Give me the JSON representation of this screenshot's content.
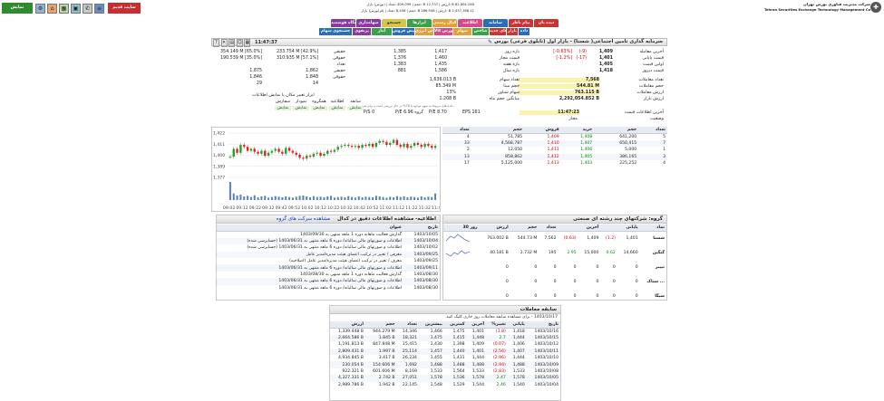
{
  "company": {
    "fa": "شرکت مدیریت فناوری بورس تهران",
    "en": "Tehran Securities Exchange Technology Management Co"
  },
  "ticker": {
    "l1": "82,804,246 B :ارزش | 12,737 B :حجم | 409,099 :تعداد | (بورس) بازار",
    "l2": "2,437,168.11 B :ارزش | 286,948 B :حجم | 8,458 :تعداد | (فرابورس) بازار"
  },
  "top_btns": {
    "site": "سایت قدیم",
    "lang": "نمایش فهرست"
  },
  "menus_row1": [
    "دیده بان",
    "پیام ناظر",
    "سامانه",
    "اطلاعیه",
    "کدال رسمی",
    "ابزارها",
    "جستجو",
    "سهامداری",
    "ایستگاه هوشمند",
    "تقویم",
    "تحلیل"
  ],
  "menus_row2": [
    "داده",
    "بازار",
    "نمادهای جدید",
    "شاخص",
    "سهام",
    "بورس کالا",
    "بورس انرژی",
    "پیش فروش",
    "آمار",
    "پرتفوی",
    "جستجوی سهام"
  ],
  "header": {
    "title": "سرمایه گذاری تامین اجتماعی( شستا) - بازار اول (تابلوی فرعی) بورس",
    "time": "11:47:37"
  },
  "price_block": {
    "rows": [
      {
        "label": "آخرین معامله",
        "val": "1,409",
        "chg": "(-9)",
        "pct": "[-0.63%]"
      },
      {
        "label": "قیمت پایانی",
        "val": "1,401",
        "chg": "(-17)",
        "pct": "[-1.2%]"
      },
      {
        "label": "اولین قیمت",
        "val": "1,405",
        "chg": "",
        "pct": ""
      },
      {
        "label": "قیمت دیروز",
        "val": "1,418",
        "chg": "",
        "pct": ""
      }
    ],
    "range": [
      {
        "label": "بازه روز",
        "a": "1,417",
        "b": "1,385"
      },
      {
        "label": "قیمت مجاز",
        "a": "1,460",
        "b": "1,376"
      },
      {
        "label": "بازه هفته",
        "a": "1,435",
        "b": "1,383"
      },
      {
        "label": "بازه سال",
        "a": "1,586",
        "b": "881"
      }
    ],
    "stats": [
      {
        "label": "تعداد معاملات",
        "val": "7,568"
      },
      {
        "label": "حجم معاملات",
        "val": "544.81 M"
      },
      {
        "label": "ارزش معاملات",
        "val": "763.115 B"
      },
      {
        "label": "ارزش بازار",
        "val": "2,292,054.852 B"
      }
    ],
    "stats2": [
      {
        "label": "تعداد سهام",
        "val": "1,636.013 B"
      },
      {
        "label": "حجم مبنا",
        "val": "85.349 M"
      },
      {
        "label": "سهام شناور",
        "val": "13%"
      },
      {
        "label": "میانگین حجم ماه",
        "val": "1.208 B"
      }
    ],
    "last_info_label": "آخرین اطلاعات قیمت",
    "last_info_val": "11:47:23",
    "status_label": "وضعیت",
    "status_val": "مجاز",
    "eps": "EPS 161",
    "pe": "P/E 8.70",
    "gpe": "P/E گروه 6.96",
    "psr": "P/S 0",
    "note": "داده های مربوط به سهم موجود با 70% در حال بررسی است و برای هر سهم..."
  },
  "clients": {
    "head": [
      "",
      "خرید",
      "فروش"
    ],
    "rows": [
      {
        "label": "حقیقی",
        "buy": "233.754 M [42.9%]",
        "sell": "354.149 M [65.0%]"
      },
      {
        "label": "حقوقی",
        "buy": "310.935 M [57.1%]",
        "sell": "190.539 M [35.0%]"
      },
      {
        "label": "تعداد",
        "buy": "",
        "sell": ""
      },
      {
        "label": "حقیقی",
        "buy": "1,862",
        "sell": "1,875"
      },
      {
        "label": "حقوقی",
        "buy": "1,848",
        "sell": "1,846"
      },
      {
        "label": "",
        "buy": "14",
        "sell": "29"
      }
    ],
    "tools_label": "ابزار تغییر مکان یا نمایش اطلاعات",
    "tools": [
      [
        "سابقه",
        "اطلاعیه",
        "همگروه",
        "نمودار",
        "سفارش"
      ],
      [
        "نمایش",
        "نمایش",
        "نمایش",
        "نمایش",
        "نمایش"
      ]
    ]
  },
  "orderbook": {
    "head": [
      "تعداد",
      "حجم",
      "خرید",
      "فروش",
      "حجم",
      "تعداد"
    ],
    "rows": [
      [
        "5",
        "641,200",
        "1,408",
        "1,409",
        "51,785",
        "4"
      ],
      [
        "7",
        "650,415",
        "1,407",
        "1,410",
        "4,568,787",
        "33"
      ],
      [
        "1",
        "5,000",
        "1,406",
        "1,411",
        "12,050",
        "2"
      ],
      [
        "3",
        "386,165",
        "1,405",
        "1,412",
        "858,862",
        "13"
      ],
      [
        "4",
        "225,252",
        "1,403",
        "1,413",
        "5,125,000",
        "17"
      ]
    ]
  },
  "chart_data": {
    "type": "line",
    "series": [
      {
        "values": [
          1398,
          1406,
          1402,
          1410,
          1408,
          1404,
          1406,
          1403,
          1401,
          1404,
          1399,
          1402,
          1404,
          1406,
          1403,
          1401,
          1407,
          1404,
          1402,
          1400,
          1397,
          1396,
          1399,
          1398,
          1401,
          1402,
          1399,
          1401,
          1404,
          1403,
          1405,
          1408,
          1409,
          1410,
          1409,
          1408,
          1409,
          1407,
          1410,
          1409,
          1411,
          1408,
          1412,
          1414,
          1413,
          1410,
          1412,
          1415,
          1410,
          1408,
          1411,
          1407,
          1409,
          1412,
          1410,
          1408,
          1411,
          1409,
          1407,
          1409
        ]
      }
    ],
    "volume": [
      60,
      22,
      15,
      18,
      12,
      14,
      10,
      16,
      9,
      12,
      14,
      8,
      10,
      13,
      11,
      9,
      12,
      10,
      8,
      11,
      14,
      15,
      12,
      9,
      13,
      10,
      11,
      9,
      12,
      14,
      8,
      10,
      11,
      9,
      13,
      10,
      8,
      12,
      9,
      11,
      10,
      9,
      14,
      12,
      10,
      8,
      11,
      9,
      13,
      10,
      12,
      9,
      11,
      10,
      8,
      12,
      9,
      11,
      10,
      22
    ],
    "yticks": [
      "1,422",
      "1,411",
      "1,400",
      "1,389",
      "1,377"
    ],
    "ylim": [
      1377,
      1422
    ],
    "xticks": [
      "09:02",
      "09:12",
      "09:22",
      "09:32",
      "09:42",
      "09:52",
      "10:02",
      "10:12",
      "10:22",
      "10:32",
      "10:42",
      "10:52",
      "11:02",
      "11:12",
      "11:22",
      "11:32",
      "11:42"
    ],
    "grid": true
  },
  "peers": {
    "title": "گروه: شرکتهای چند رشته ای صنعتی",
    "head": [
      "نماد",
      "پایانی",
      "",
      "آخرین",
      "",
      "تعداد",
      "حجم",
      "ارزش",
      "30 روز"
    ],
    "rows": [
      [
        "شستا",
        "1,401",
        "(1.2)",
        "1,409",
        "(0.63)",
        "7,562",
        "544.73 M",
        "763.002 B"
      ],
      [
        "گنگین",
        "14,660",
        "0.62",
        "15,000",
        "2.95",
        "195",
        "2.732 M",
        "40.181 B"
      ],
      [
        "تیپیر",
        "0",
        "0",
        "0",
        "0",
        "0",
        "0",
        "0"
      ],
      [
        "ستاک ...",
        "0",
        "0",
        "0",
        "0",
        "0",
        "0",
        "0"
      ],
      [
        "سیگا",
        "0",
        "0",
        "0",
        "0",
        "0",
        "0",
        "0"
      ]
    ]
  },
  "news": {
    "title": "اطلاعیه- مشاهده اطلاعات دقیق در کدال",
    "link": "مشاهده سرکت های گروه",
    "head": [
      "تاریخ",
      "عنوان"
    ],
    "rows": [
      [
        "1403/10/05",
        "گذارش فعالیت ماهانه دوره 1 ماهه منتهی به 1403/09/30"
      ],
      [
        "1403/10/04",
        "اطلاعات و صورتهای مالی سالیانه/ دوره 6 ماهه منتهی به 1403/06/31 (حسابرسی شده)"
      ],
      [
        "1403/10/02",
        "اطلاعات و صورتهای مالی سالیانه/ دوره 6 ماهه منتهی به 1403/06/31 (حسابرسی شده)"
      ],
      [
        "1403/09/25",
        "معرفی / تغییر در ترکیب اعضای هیئت مدیره/مدیر عامل"
      ],
      [
        "1403/09/25",
        "معرف / تغییر در ترکیب اعضای هیئت مدیره/مدیر عامل (اصلاحیه)"
      ],
      [
        "1403/09/11",
        "اطلاعات و صورتهای مالی سالیانه/ دوره 6 ماهه منتهی به 1403/06/31"
      ],
      [
        "1403/08/30",
        "گذارش فعالیت ماهانه دوره 1 ماهه منتهی به 1403/08/30"
      ],
      [
        "1403/08/30",
        "اطلاعات و صورتهای مالی سالیانه/ دوره 6 ماهه منتهی به 1403/06/31"
      ],
      [
        "1403/08/30",
        "اطلاعات و صورتهای مالی سالیانه/ دوره 6 ماهه منتهی به 1403/06/31"
      ]
    ]
  },
  "history": {
    "title": "سابقه معاملات",
    "sub": "1403/10/17 - برای مشاهده سابقه معاملات روز جاری کلیک کنید",
    "head": [
      "تاریخ",
      "پایانی",
      "%تغییر",
      "آخرین",
      "کمترین",
      "بیشترین",
      "تعداد",
      "حجم",
      "ارزش"
    ],
    "rows": [
      [
        "1403/10/16",
        "1,418",
        "(1.8)",
        "1,401",
        "1,475",
        "1,466",
        "14,346",
        "944.279 M",
        "1,339.448 B"
      ],
      [
        "1403/10/15",
        "1,444",
        "2.7",
        "1,448",
        "1,415",
        "1,475",
        "18,321",
        "1.845 B",
        "2,664.586 B"
      ],
      [
        "1403/10/12",
        "1,406",
        "(0.07)",
        "1,409",
        "1,398",
        "1,430",
        "15,415",
        "847.848 M",
        "1,191.813 B"
      ],
      [
        "1403/10/11",
        "1,407",
        "(2.56)",
        "1,401",
        "1,440",
        "1,457",
        "25,114",
        "1.997 B",
        "2,809.431 B"
      ],
      [
        "1403/10/10",
        "1,444",
        "(2.96)",
        "1,444",
        "1,431",
        "1,455",
        "26,234",
        "3.417 B",
        "4,934.845 B"
      ],
      [
        "1403/10/09",
        "1,488",
        "(2.94)",
        "1,488",
        "1,488",
        "1,488",
        "1,692",
        "154.606 M",
        "230.054 B"
      ],
      [
        "1403/10/08",
        "1,533",
        "(2.83)",
        "1,533",
        "1,564",
        "1,533",
        "8,169",
        "601.606 M",
        "922.321 B"
      ],
      [
        "1403/10/05",
        "1,578",
        "2.47",
        "1,578",
        "1,536",
        "1,578",
        "27,051",
        "2.742 B",
        "4,327.331 B"
      ],
      [
        "1403/10/04",
        "1,540",
        "2.46",
        "1,544",
        "1,529",
        "1,548",
        "22,145",
        "1.942 B",
        "2,989.786 B"
      ]
    ]
  }
}
